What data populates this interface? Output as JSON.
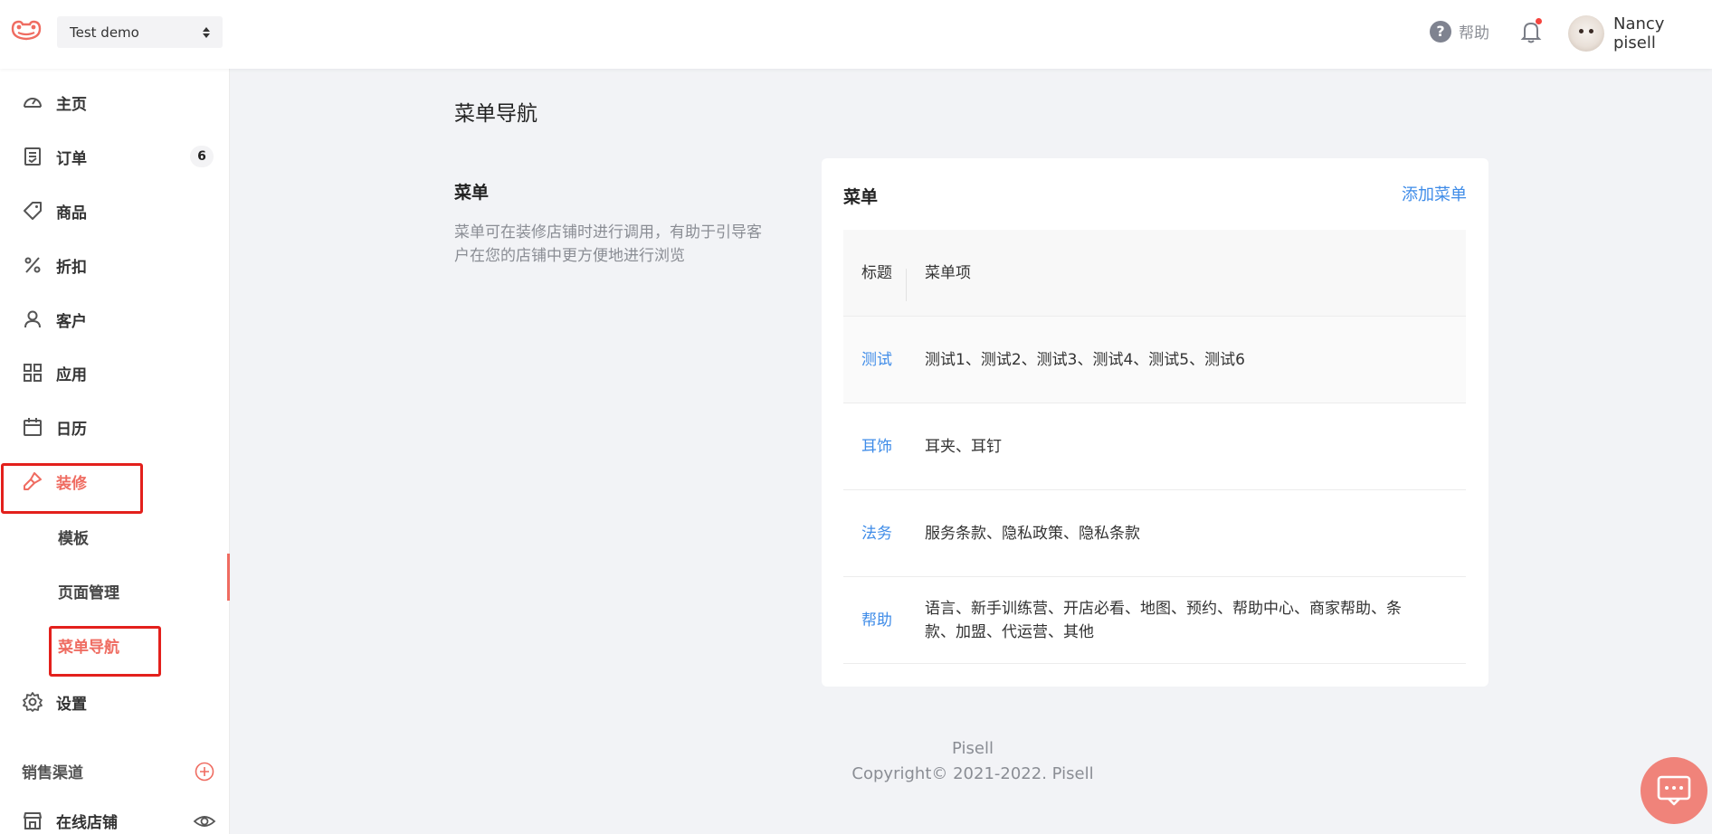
{
  "header": {
    "store_name": "Test demo",
    "help_label": "帮助",
    "user_name": "Nancy pisell"
  },
  "sidebar": {
    "items": [
      {
        "label": "主页",
        "icon": "dashboard-icon"
      },
      {
        "label": "订单",
        "icon": "order-icon",
        "badge": "6"
      },
      {
        "label": "商品",
        "icon": "tag-icon"
      },
      {
        "label": "折扣",
        "icon": "percent-icon"
      },
      {
        "label": "客户",
        "icon": "user-icon"
      },
      {
        "label": "应用",
        "icon": "apps-icon"
      },
      {
        "label": "日历",
        "icon": "calendar-icon"
      },
      {
        "label": "装修",
        "icon": "brush-icon"
      }
    ],
    "sub_items": [
      {
        "label": "模板"
      },
      {
        "label": "页面管理"
      },
      {
        "label": "菜单导航"
      }
    ],
    "settings_label": "设置",
    "channels_label": "销售渠道",
    "online_store_label": "在线店铺",
    "accent_color": "#ef6c61"
  },
  "main": {
    "page_title": "菜单导航",
    "section_title": "菜单",
    "section_desc": "菜单可在装修店铺时进行调用，有助于引导客户在您的店铺中更方便地进行浏览"
  },
  "card": {
    "title": "菜单",
    "add_label": "添加菜单",
    "columns": [
      "标题",
      "菜单项"
    ],
    "rows": [
      {
        "title": "测试",
        "items": "测试1、测试2、测试3、测试4、测试5、测试6"
      },
      {
        "title": "耳饰",
        "items": "耳夹、耳钉"
      },
      {
        "title": "法务",
        "items": "服务条款、隐私政策、隐私条款"
      },
      {
        "title": "帮助",
        "items": "语言、新手训练营、开店必看、地图、预约、帮助中心、商家帮助、条款、加盟、代运营、其他"
      }
    ],
    "link_color": "#3f8ce8"
  },
  "footer": {
    "line1": "Pisell",
    "line2": "Copyright© 2021-2022. Pisell"
  }
}
